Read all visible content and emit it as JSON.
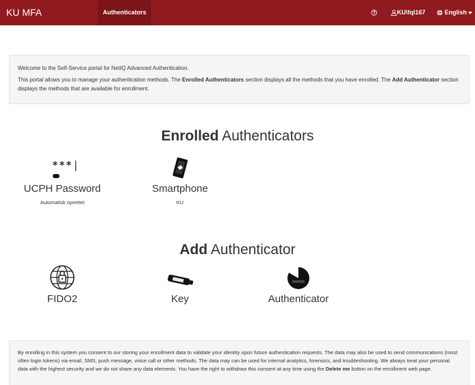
{
  "topbar": {
    "brand": "KU MFA",
    "nav_active": "Authenticators",
    "help_icon": "question-circle-icon",
    "user_label": "KU\\fql167",
    "user_icon": "user-icon",
    "language_label": "English",
    "language_icon": "globe-icon",
    "background_color": "#901a1e",
    "active_tab_color": "#7c1418"
  },
  "welcome": {
    "line1": "Welcome to the Self-Service portal for NetIQ Advanced Authentication.",
    "p2_a": "This portal allows you to manage your authentication methods. The ",
    "p2_b": "Enrolled Authenticators",
    "p2_c": " section displays all the methods that you have enrolled. The ",
    "p2_d": "Add Authenticator",
    "p2_e": " section displays the methods that are available for enrollment."
  },
  "enrolled": {
    "title_bold": "Enrolled",
    "title_rest": " Authenticators",
    "items": [
      {
        "name": "UCPH Password",
        "sub": "Automatisk oprettet",
        "icon": "password-icon",
        "glyph": "***"
      },
      {
        "name": "Smartphone",
        "sub": "KU",
        "icon": "smartphone-icon"
      }
    ]
  },
  "add": {
    "title_bold": "Add",
    "title_rest": " Authenticator",
    "items": [
      {
        "name": "FIDO2",
        "icon": "fido2-globe-icon"
      },
      {
        "name": "Key",
        "icon": "usb-key-icon"
      },
      {
        "name": "Authenticator",
        "icon": "authenticator-timer-icon"
      }
    ]
  },
  "consent": {
    "text_a": "By enrolling in this system you consent to our storing your enrollment data to validate your identity upon future authentication requests. The data may also be used to send communications (most often login tokens) via email, SMS, push message, voice call or other methods. The data may can be used for internal analytics, forensics, and troubleshooting. We always treat your personal data with the highest security and we do not share any data elements. You have the right to withdraw this consent at any time using the ",
    "text_b": "Delete me",
    "text_c": " button on the enrollment web page."
  }
}
